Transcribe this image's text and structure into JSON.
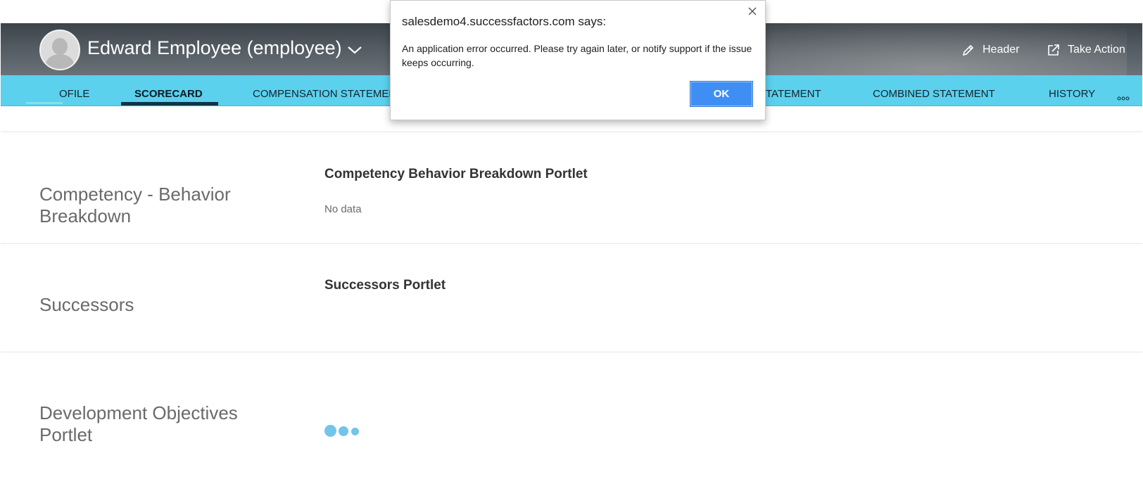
{
  "header": {
    "employee_name": "Edward Employee (employee)",
    "actions": {
      "header_label": "Header",
      "take_action_label": "Take Action"
    }
  },
  "tabs": [
    {
      "label": "OFILE"
    },
    {
      "label": "SCORECARD",
      "active": true
    },
    {
      "label": "COMPENSATION STATEMENT"
    },
    {
      "label": "STATEMENT"
    },
    {
      "label": "COMBINED STATEMENT"
    },
    {
      "label": "HISTORY"
    }
  ],
  "sections": [
    {
      "title": "Competency - Behavior Breakdown",
      "portlet_title": "Competency Behavior Breakdown Portlet",
      "content": "No data"
    },
    {
      "title": "Successors",
      "portlet_title": "Successors Portlet"
    },
    {
      "title": "Development Objectives Portlet"
    }
  ],
  "dialog": {
    "title": "salesdemo4.successfactors.com says:",
    "message": "An application error occurred. Please try again later, or notify support if the issue keeps occurring.",
    "ok_label": "OK"
  },
  "colors": {
    "tab_bar": "#5bd1ee",
    "active_tab_underline": "#0e3447",
    "ok_button": "#3f8ef4",
    "loader_dots": "#73c4ea"
  },
  "icons": {
    "avatar": "default-user-avatar",
    "name_menu": "chevron-down-icon",
    "header_action": "pencil-icon",
    "take_action": "external-link-icon",
    "tab_overflow": "more-dots-icon",
    "dialog_close": "close-icon",
    "loading": "loading-dots-icon"
  }
}
